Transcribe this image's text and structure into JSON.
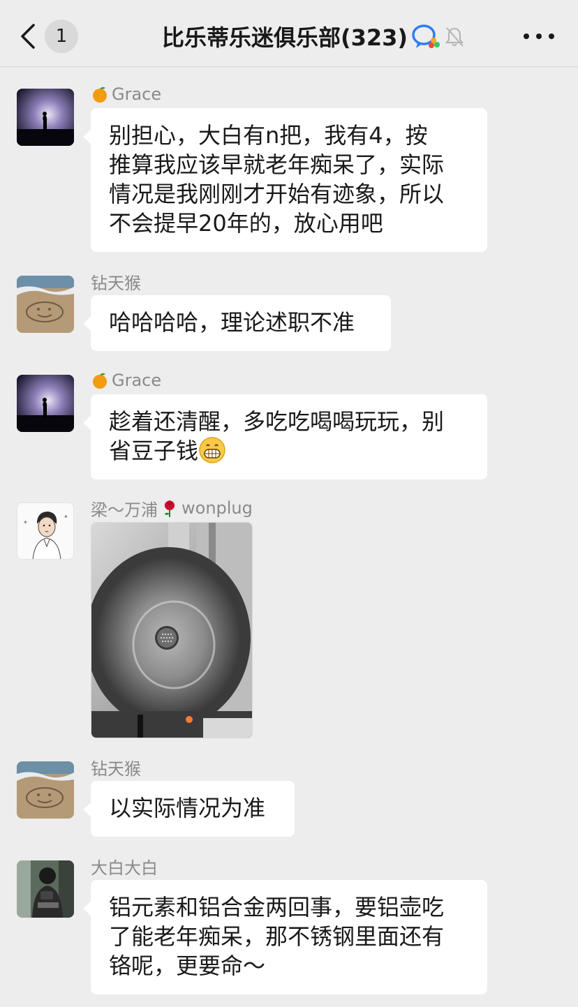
{
  "header": {
    "unread_count": "1",
    "title": "比乐蒂乐迷俱乐部(323)"
  },
  "messages": [
    {
      "sender": "Grace",
      "sender_prefix_icon": "orange-emoji",
      "avatar": "night-silhouette",
      "lines": [
        "别担心，大白有n把，我有4，按",
        "推算我应该早就老年痴呆了，实际",
        "情况是我刚刚才开始有迹象，所以",
        "不会提早20年的，放心用吧"
      ]
    },
    {
      "sender": "钻天猴",
      "avatar": "sand-smiley",
      "lines": [
        "哈哈哈哈，理论述职不准"
      ]
    },
    {
      "sender": "Grace",
      "sender_prefix_icon": "orange-emoji",
      "avatar": "night-silhouette",
      "lines": [
        "趁着还清醒，多吃吃喝喝玩玩，别",
        "省豆子钱"
      ],
      "trailing_emoji": "grin-emoji"
    },
    {
      "sender_parts": [
        "梁～万浦",
        "wonplug"
      ],
      "sender_middle_icon": "rose-emoji",
      "avatar": "cartoon-man",
      "image": "steel-kettle-interior"
    },
    {
      "sender": "钻天猴",
      "avatar": "sand-smiley",
      "lines": [
        "以实际情况为准"
      ]
    },
    {
      "sender": "大白大白",
      "avatar": "person-photo",
      "lines": [
        "铝元素和铝合金两回事，要铝壶吃",
        "了能老年痴呆，那不锈钢里面还有",
        "铬呢，更要命～"
      ]
    }
  ],
  "colors": {
    "background": "#ededed",
    "bubble": "#ffffff",
    "text": "#191919",
    "sender": "#8a8a8a"
  }
}
